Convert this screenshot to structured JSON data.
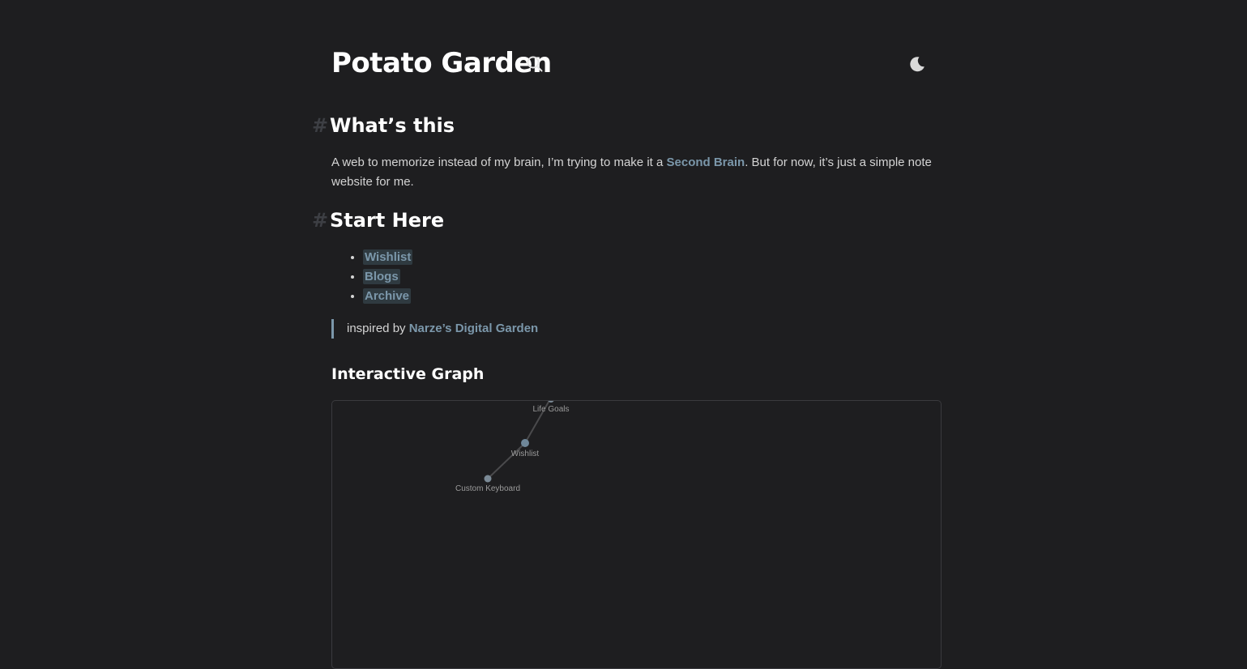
{
  "header": {
    "title": "Potato Garden",
    "search_icon": "search-icon",
    "theme_icon": "moon-icon"
  },
  "sections": {
    "whats_this": {
      "heading": "What’s this",
      "text_before": "A web to memorize instead of my brain, I’m trying to make it a ",
      "link": "Second Brain",
      "text_after": ". But for now, it’s just a simple note website for me."
    },
    "start_here": {
      "heading": "Start Here",
      "items": [
        {
          "label": "Wishlist"
        },
        {
          "label": "Blogs"
        },
        {
          "label": "Archive"
        }
      ]
    }
  },
  "quote": {
    "prefix": "inspired by ",
    "link": "Narze’s Digital Garden"
  },
  "graph": {
    "title": "Interactive Graph",
    "nodes": [
      {
        "label": "Life Goals"
      },
      {
        "label": "Wishlist"
      },
      {
        "label": "Custom Keyboard"
      }
    ]
  },
  "colors": {
    "background": "#1e1e20",
    "link": "#7b97aa",
    "hash": "#3d3f44"
  }
}
